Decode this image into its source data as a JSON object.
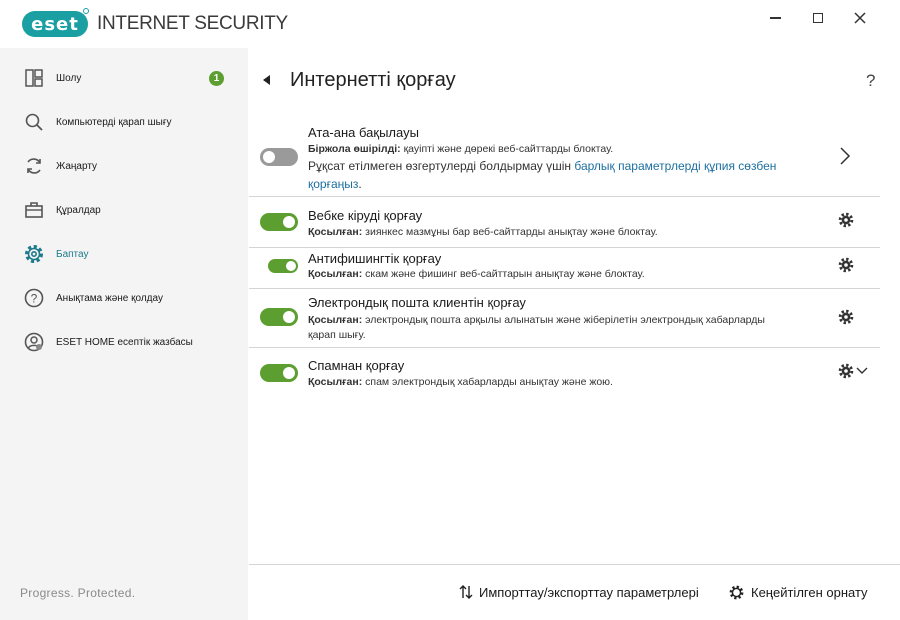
{
  "app": {
    "logo_text": "eset",
    "product_name": "INTERNET SECURITY",
    "accent_color": "#1a9fa3",
    "tagline": "Progress. Protected."
  },
  "window_controls": [
    "minimize-icon",
    "maximize-icon",
    "close-icon"
  ],
  "sidebar": {
    "items": [
      {
        "label": "Шолу",
        "icon": "dashboard-icon",
        "badge": "1"
      },
      {
        "label": "Компьютерді қарап шығу",
        "icon": "search-icon"
      },
      {
        "label": "Жаңарту",
        "icon": "refresh-icon"
      },
      {
        "label": "Құралдар",
        "icon": "toolbox-icon"
      },
      {
        "label": "Баптау",
        "icon": "gear-icon",
        "active": true
      },
      {
        "label": "Анықтама және қолдау",
        "icon": "help-icon"
      },
      {
        "label": "ESET HOME есептік жазбасы",
        "icon": "account-icon"
      }
    ]
  },
  "main": {
    "title": "Интернетті қорғау",
    "help": "?",
    "rows": [
      {
        "title": "Ата-ана бақылауы",
        "status": "Біржола өшірілді:",
        "desc": " қауіпті және дөрекі веб-сайттарды блоктау.",
        "extra_text": "Рұқсат етілмеген өзгертулерді болдырмау үшін ",
        "extra_link": "барлық параметрлерді құпия сөзбен қорғаңыз",
        "extra_end": ".",
        "toggle": "off"
      },
      {
        "title": "Вебке кіруді қорғау",
        "status": "Қосылған:",
        "desc": " зиянкес мазмұны бар веб-сайттарды анықтау және блоктау.",
        "toggle": "on"
      },
      {
        "title": "Антифишингтік қорғау",
        "status": "Қосылған:",
        "desc": " скам және фишинг веб-сайттарын анықтау және блоктау.",
        "toggle": "on"
      },
      {
        "title": "Электрондық пошта клиентін қорғау",
        "status": "Қосылған:",
        "desc": " электрондық пошта арқылы алынатын және жіберілетін электрондық хабарларды қарап шығу.",
        "toggle": "on"
      },
      {
        "title": "Спамнан қорғау",
        "status": "Қосылған:",
        "desc": " спам электрондық хабарларды анықтау және жою.",
        "toggle": "on"
      }
    ]
  },
  "footer": {
    "import_export": "Импорттау/экспорттау параметрлері",
    "advanced_setup": "Кеңейтілген орнату"
  }
}
